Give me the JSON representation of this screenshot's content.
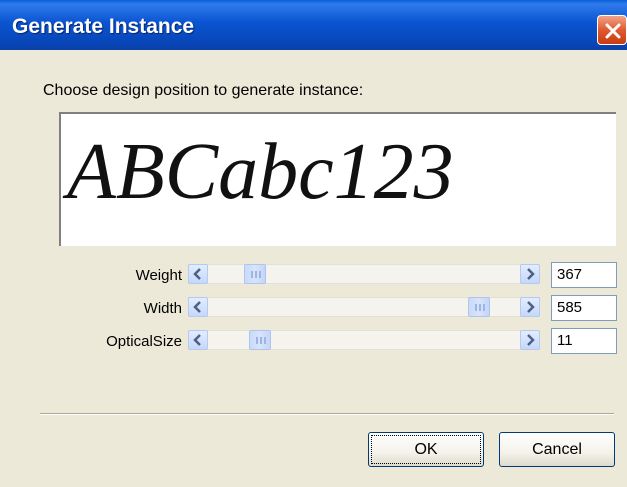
{
  "window": {
    "title": "Generate Instance"
  },
  "dialog": {
    "prompt": "Choose design position to generate instance:",
    "preview_text": "ABCabc123",
    "axes": [
      {
        "label": "Weight",
        "value": "367",
        "slider_fraction": 0.12
      },
      {
        "label": "Width",
        "value": "585",
        "slider_fraction": 0.9
      },
      {
        "label": "OpticalSize",
        "value": "11",
        "slider_fraction": 0.14
      }
    ]
  },
  "buttons": {
    "ok": "OK",
    "cancel": "Cancel"
  },
  "icons": {
    "close": "close-icon",
    "scroll_left": "chevron-left-icon",
    "scroll_right": "chevron-right-icon"
  },
  "colors": {
    "titlebar": "#0A54D2",
    "face": "#ECE9D8",
    "close": "#E05A2E",
    "scroll_button": "#C5D7FB"
  }
}
